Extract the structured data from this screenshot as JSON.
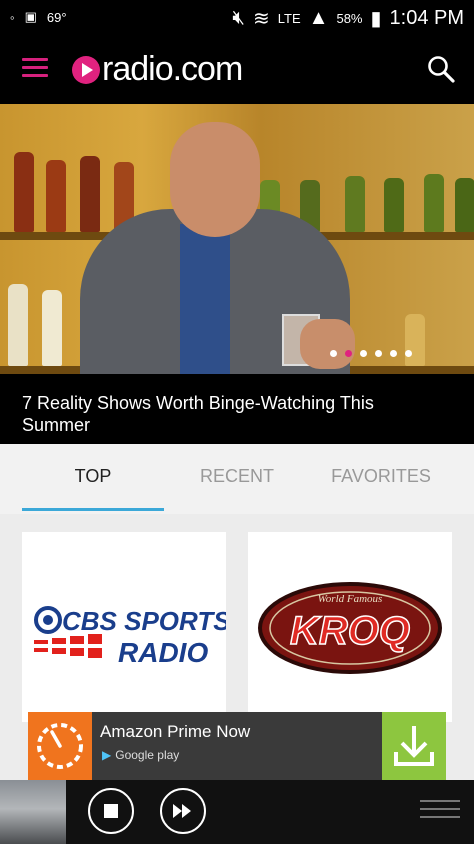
{
  "status": {
    "signal": "69°",
    "network": "LTE",
    "battery": "58%",
    "time": "1:04 PM"
  },
  "app": {
    "logo_text": "radio.com"
  },
  "hero": {
    "caption": "7 Reality Shows Worth Binge-Watching This Summer",
    "dots_count": 6,
    "active_dot": 1
  },
  "tabs": [
    {
      "label": "TOP",
      "active": true
    },
    {
      "label": "RECENT",
      "active": false
    },
    {
      "label": "FAVORITES",
      "active": false
    }
  ],
  "stations": [
    {
      "name": "CBS SPORTS RADIO",
      "line1": "CBS SPORTS",
      "line2": "RADIO"
    },
    {
      "name": "KROQ",
      "line1": "KROQ",
      "tagline": "World Famous"
    }
  ],
  "ad": {
    "title": "Amazon Prime Now",
    "store": "Google play"
  },
  "colors": {
    "accent": "#e0227f",
    "tab_underline": "#3ba8d8",
    "ad_download": "#8dc63f"
  }
}
